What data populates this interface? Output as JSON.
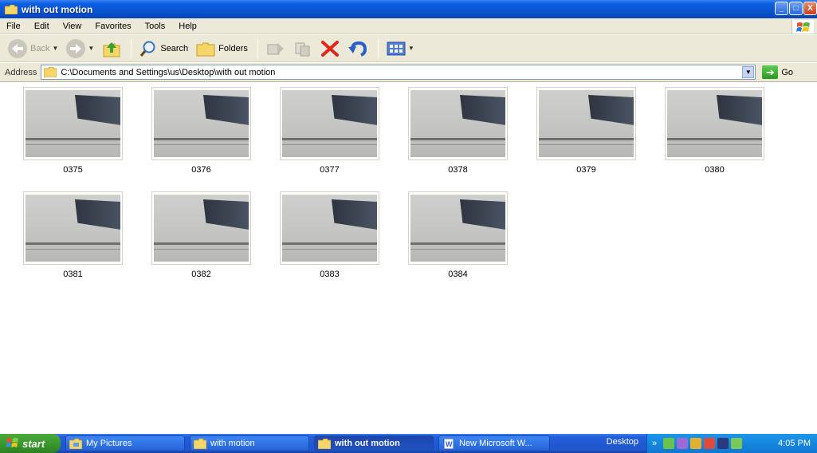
{
  "window": {
    "title": "with out motion",
    "controls": [
      "_",
      "□",
      "X"
    ]
  },
  "menu": [
    "File",
    "Edit",
    "View",
    "Favorites",
    "Tools",
    "Help"
  ],
  "toolbar": {
    "back_label": "Back",
    "search_label": "Search",
    "folders_label": "Folders"
  },
  "address": {
    "label": "Address",
    "path": "C:\\Documents and Settings\\us\\Desktop\\with out motion",
    "go_label": "Go"
  },
  "files": [
    {
      "name": "0375"
    },
    {
      "name": "0376"
    },
    {
      "name": "0377"
    },
    {
      "name": "0378"
    },
    {
      "name": "0379"
    },
    {
      "name": "0380"
    },
    {
      "name": "0381"
    },
    {
      "name": "0382"
    },
    {
      "name": "0383"
    },
    {
      "name": "0384"
    }
  ],
  "taskbar": {
    "start_label": "start",
    "tasks": [
      {
        "label": "My Pictures"
      },
      {
        "label": "with motion"
      },
      {
        "label": "with out motion",
        "active": true
      },
      {
        "label": "New Microsoft W..."
      }
    ],
    "desktop_label": "Desktop",
    "clock": "4:05 PM"
  },
  "colors": {
    "titlebar": "#0b54d0",
    "chrome": "#ece9d8",
    "start": "#3a9a2c",
    "taskbar": "#245edb"
  }
}
